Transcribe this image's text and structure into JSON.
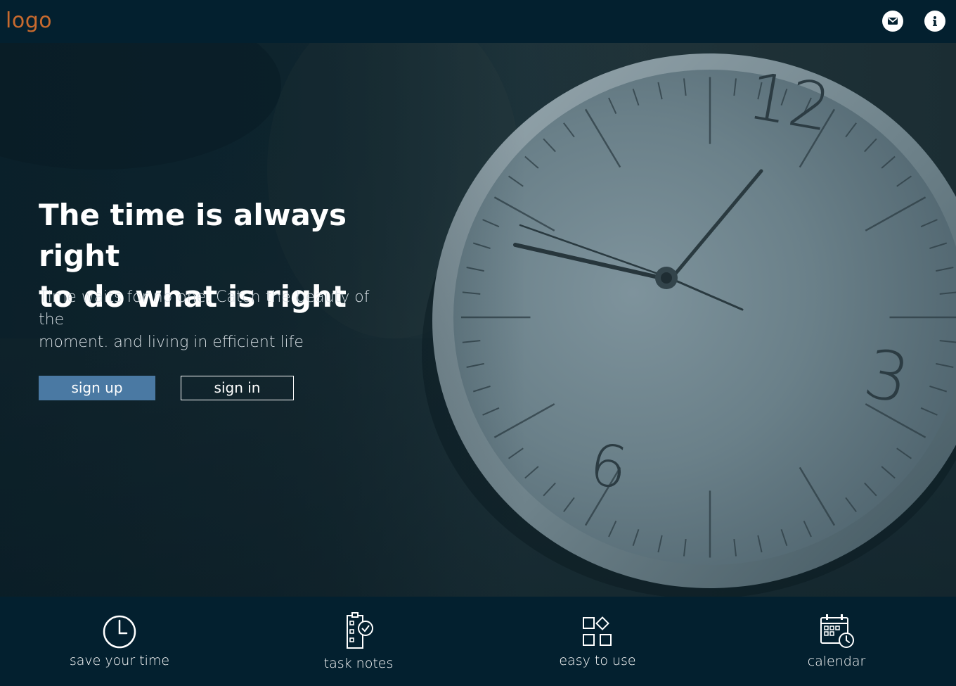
{
  "header": {
    "logo": "logo",
    "mail_icon": "mail-icon",
    "info_icon": "info-icon"
  },
  "hero": {
    "headline_line1": "The time is always right",
    "headline_line2": "to do what is right",
    "subtext_line1": "Time waits for no one. Catch the beauty of the",
    "subtext_line2": "moment. and living in efficient life",
    "signup_label": "sign up",
    "signin_label": "sign in",
    "clock_numerals": [
      "12",
      "3",
      "6"
    ]
  },
  "features": [
    {
      "label": "save your time",
      "icon": "clock-icon"
    },
    {
      "label": "task notes",
      "icon": "clipboard-check-icon"
    },
    {
      "label": "easy to use",
      "icon": "grid-shapes-icon"
    },
    {
      "label": "calendar",
      "icon": "calendar-clock-icon"
    }
  ],
  "colors": {
    "background": "#03202f",
    "logo": "#c86a2e",
    "primary_button": "#4a79a3",
    "text": "#ffffff"
  }
}
